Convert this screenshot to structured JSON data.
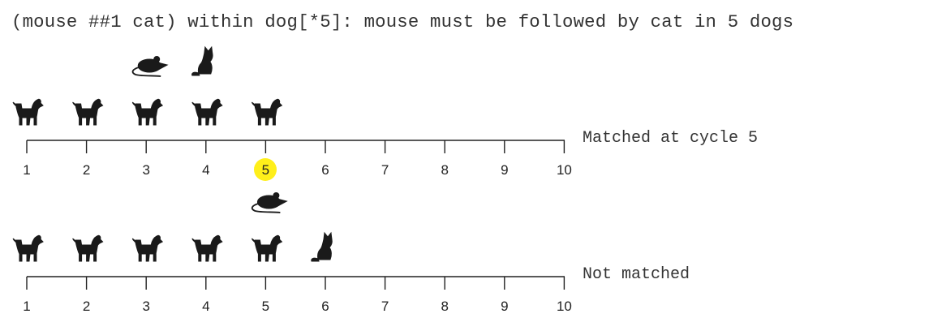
{
  "header": {
    "expression": "(mouse ##1 cat) within dog[*5]: mouse must be followed by cat in 5 dogs"
  },
  "timelines": [
    {
      "ticks": [
        "1",
        "2",
        "3",
        "4",
        "5",
        "6",
        "7",
        "8",
        "9",
        "10"
      ],
      "dogs_at": [
        1,
        2,
        3,
        4,
        5
      ],
      "mouse_at": 3,
      "cat_at": 4,
      "highlight_at": 5,
      "status": "Matched at cycle 5"
    },
    {
      "ticks": [
        "1",
        "2",
        "3",
        "4",
        "5",
        "6",
        "7",
        "8",
        "9",
        "10"
      ],
      "dogs_at": [
        1,
        2,
        3,
        4,
        5
      ],
      "mouse_at": 5,
      "cat_at": 6,
      "highlight_at": null,
      "status": "Not matched"
    }
  ],
  "colors": {
    "line": "#222222",
    "icon": "#1a1a1a",
    "highlight_fill": "#ffef1a",
    "highlight_text": "#d0000f"
  },
  "icons": [
    "dog-icon",
    "mouse-icon",
    "cat-icon"
  ]
}
